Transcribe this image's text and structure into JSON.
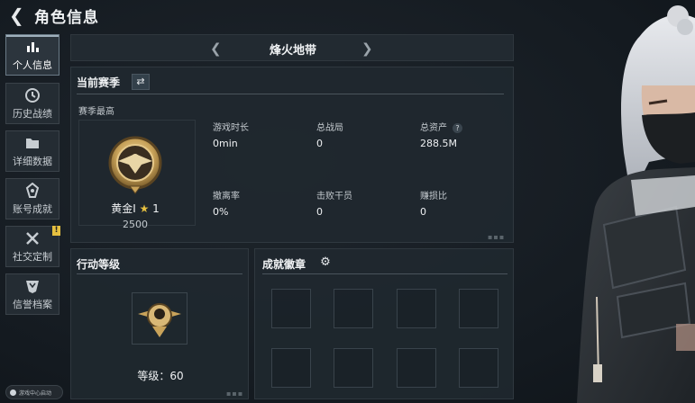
{
  "header": {
    "title": "角色信息"
  },
  "sidebar": {
    "items": [
      {
        "label": "个人信息",
        "icon": "bar-chart-icon",
        "active": true
      },
      {
        "label": "历史战绩",
        "icon": "history-clock-icon"
      },
      {
        "label": "详细数据",
        "icon": "folder-icon"
      },
      {
        "label": "账号成就",
        "icon": "achievement-icon"
      },
      {
        "label": "社交定制",
        "icon": "tools-icon",
        "badge": "!"
      },
      {
        "label": "信誉档案",
        "icon": "shield-icon"
      }
    ]
  },
  "footer": {
    "game_center_label": "游戏中心启动"
  },
  "mode_selector": {
    "title": "烽火地带",
    "prev_icon": "chevron-left-icon",
    "next_icon": "chevron-right-icon"
  },
  "season_panel": {
    "title": "当前赛季",
    "switch_icon": "swap-icon",
    "best_label": "赛季最高",
    "rank": {
      "name": "黄金I",
      "stars": "1",
      "score": "2500"
    },
    "stats": [
      {
        "label": "游戏时长",
        "value": "0min"
      },
      {
        "label": "总战局",
        "value": "0"
      },
      {
        "label": "总资产",
        "value": "288.5M",
        "help": "?"
      },
      {
        "label": "撤离率",
        "value": "0%"
      },
      {
        "label": "击败干员",
        "value": "0"
      },
      {
        "label": "赚损比",
        "value": "0"
      }
    ]
  },
  "action_panel": {
    "title": "行动等级",
    "level_label": "等级：",
    "level_value": "60"
  },
  "badge_panel": {
    "title": "成就徽章",
    "settings_icon": "gear-icon"
  },
  "colors": {
    "accent_gold": "#c9a35a",
    "badge_yellow": "#e6c040",
    "bg": "#161c22"
  }
}
